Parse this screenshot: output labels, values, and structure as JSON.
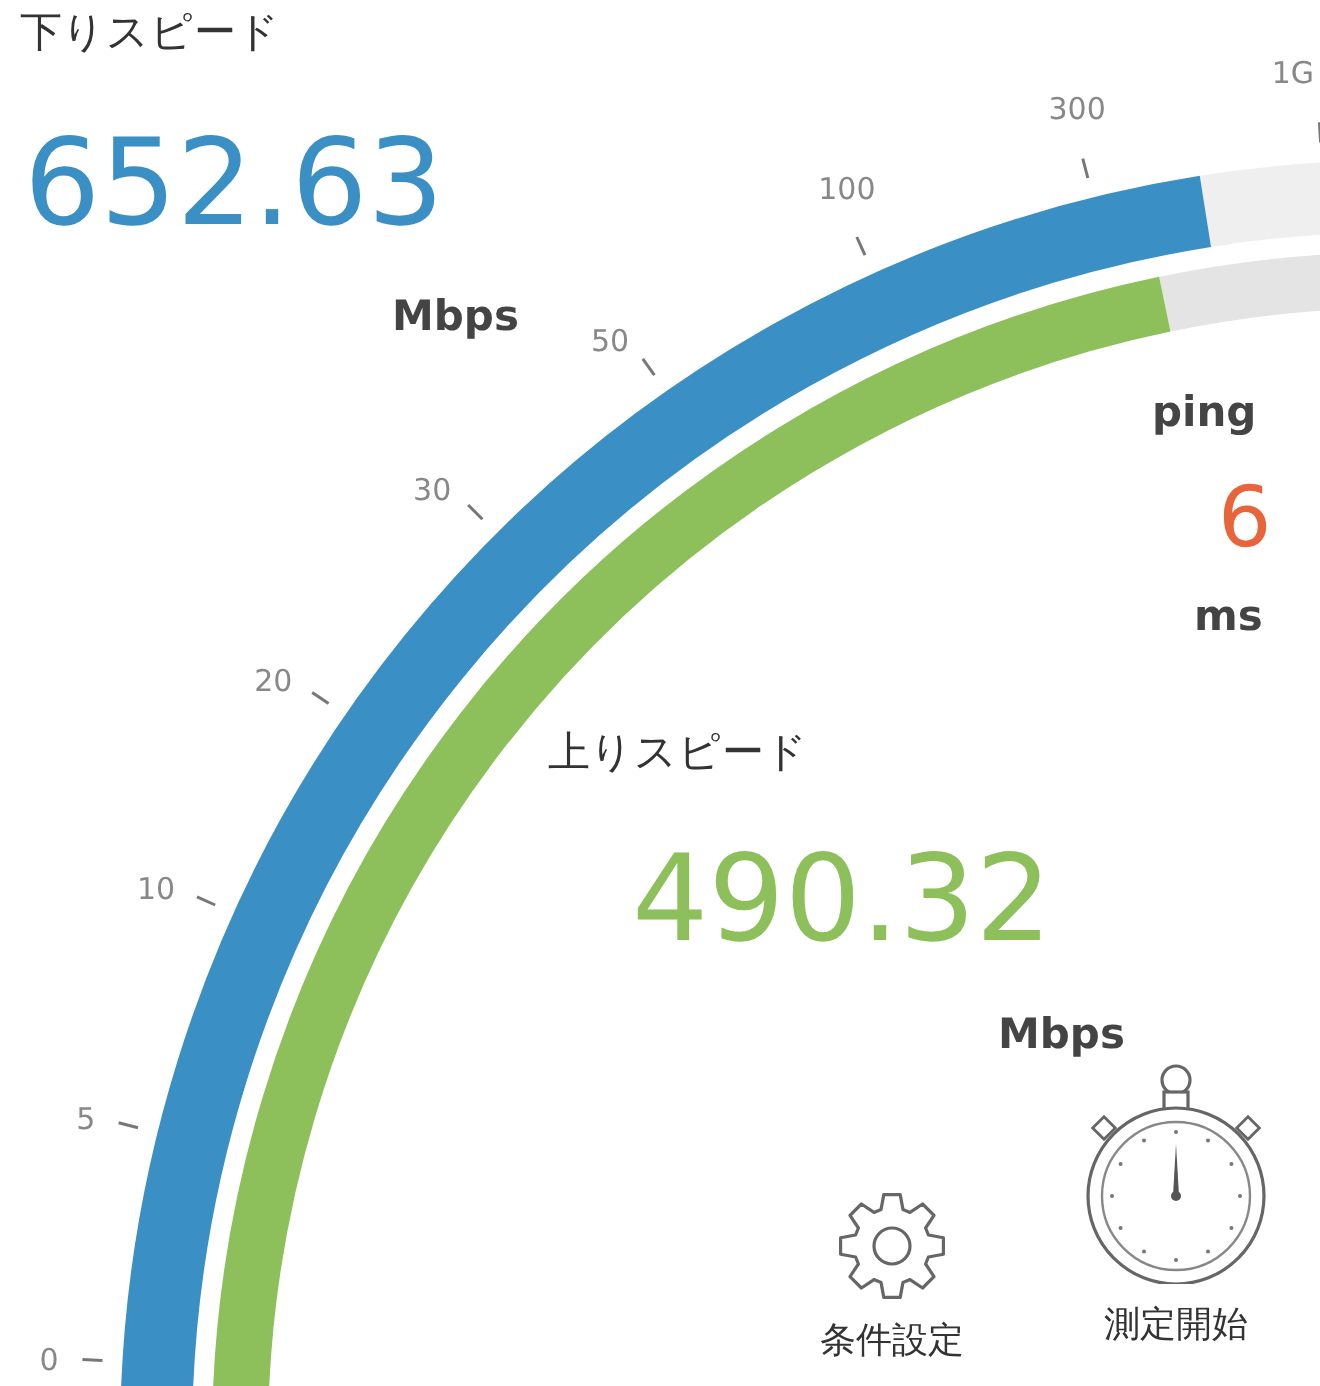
{
  "download": {
    "label": "下りスピード",
    "value": "652.63",
    "unit": "Mbps"
  },
  "upload": {
    "label": "上りスピード",
    "value": "490.32",
    "unit": "Mbps"
  },
  "ping": {
    "label": "ping",
    "value": "6",
    "unit": "ms"
  },
  "scale": {
    "ticks": [
      "0",
      "5",
      "10",
      "20",
      "30",
      "50",
      "100",
      "300",
      "1G"
    ]
  },
  "buttons": [
    {
      "kind": "settings",
      "label": "条件設定"
    },
    {
      "kind": "start",
      "label": "測定開始"
    }
  ]
}
